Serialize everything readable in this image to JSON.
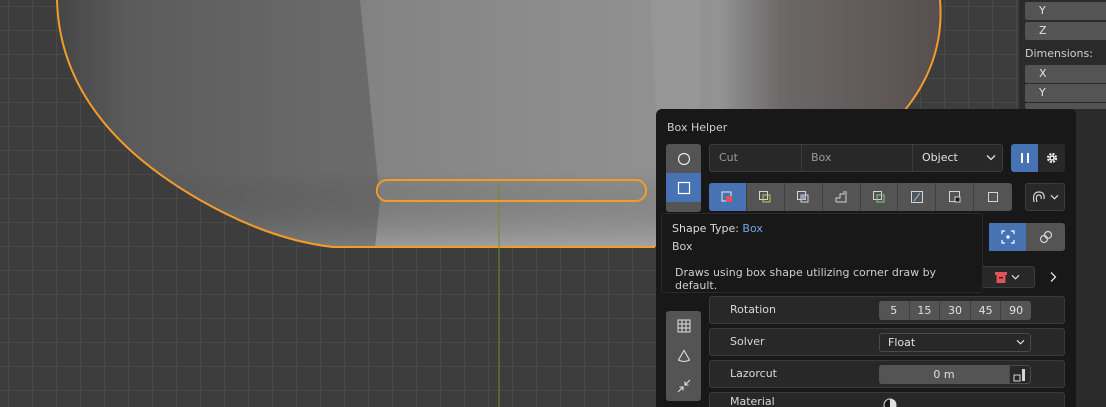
{
  "viewport": {
    "colors": {
      "outline": "#f39c2a",
      "axis": "#6f8d27"
    }
  },
  "npanel": {
    "fields_top": [
      "Y",
      "Z"
    ],
    "dimensions_label": "Dimensions:",
    "fields_dims": [
      "X",
      "Y"
    ]
  },
  "popup": {
    "title": "Box Helper",
    "fields": {
      "cut_placeholder": "Cut",
      "shape_value": "Box",
      "target_value": "Object"
    },
    "side_tools": [
      "circle-icon",
      "box-icon",
      "grid-icon",
      "cone-icon",
      "collapse-icon"
    ],
    "mode_buttons": [
      "cut-mode-icon",
      "slice-mode-icon",
      "intersect-mode-icon",
      "inset-mode-icon",
      "join-mode-icon",
      "knife-mode-icon",
      "extract-mode-icon",
      "make-mode-icon"
    ],
    "rows": {
      "rotation": {
        "label": "Rotation",
        "values": [
          "5",
          "15",
          "30",
          "45",
          "90"
        ]
      },
      "solver": {
        "label": "Solver",
        "value": "Float"
      },
      "lazorcut": {
        "label": "Lazorcut",
        "value": "0 m"
      },
      "material": {
        "label": "Material"
      }
    }
  },
  "tooltip": {
    "shape_type_label": "Shape Type:",
    "shape_type_value": "Box",
    "name": "Box",
    "description": "Draws using box shape utilizing corner draw by default."
  },
  "colors": {
    "accent": "#4772b3",
    "panel_bg": "#181818",
    "field_bg": "#282828",
    "button_bg": "#545454",
    "link": "#71a8ea",
    "danger": "#e0535c"
  }
}
